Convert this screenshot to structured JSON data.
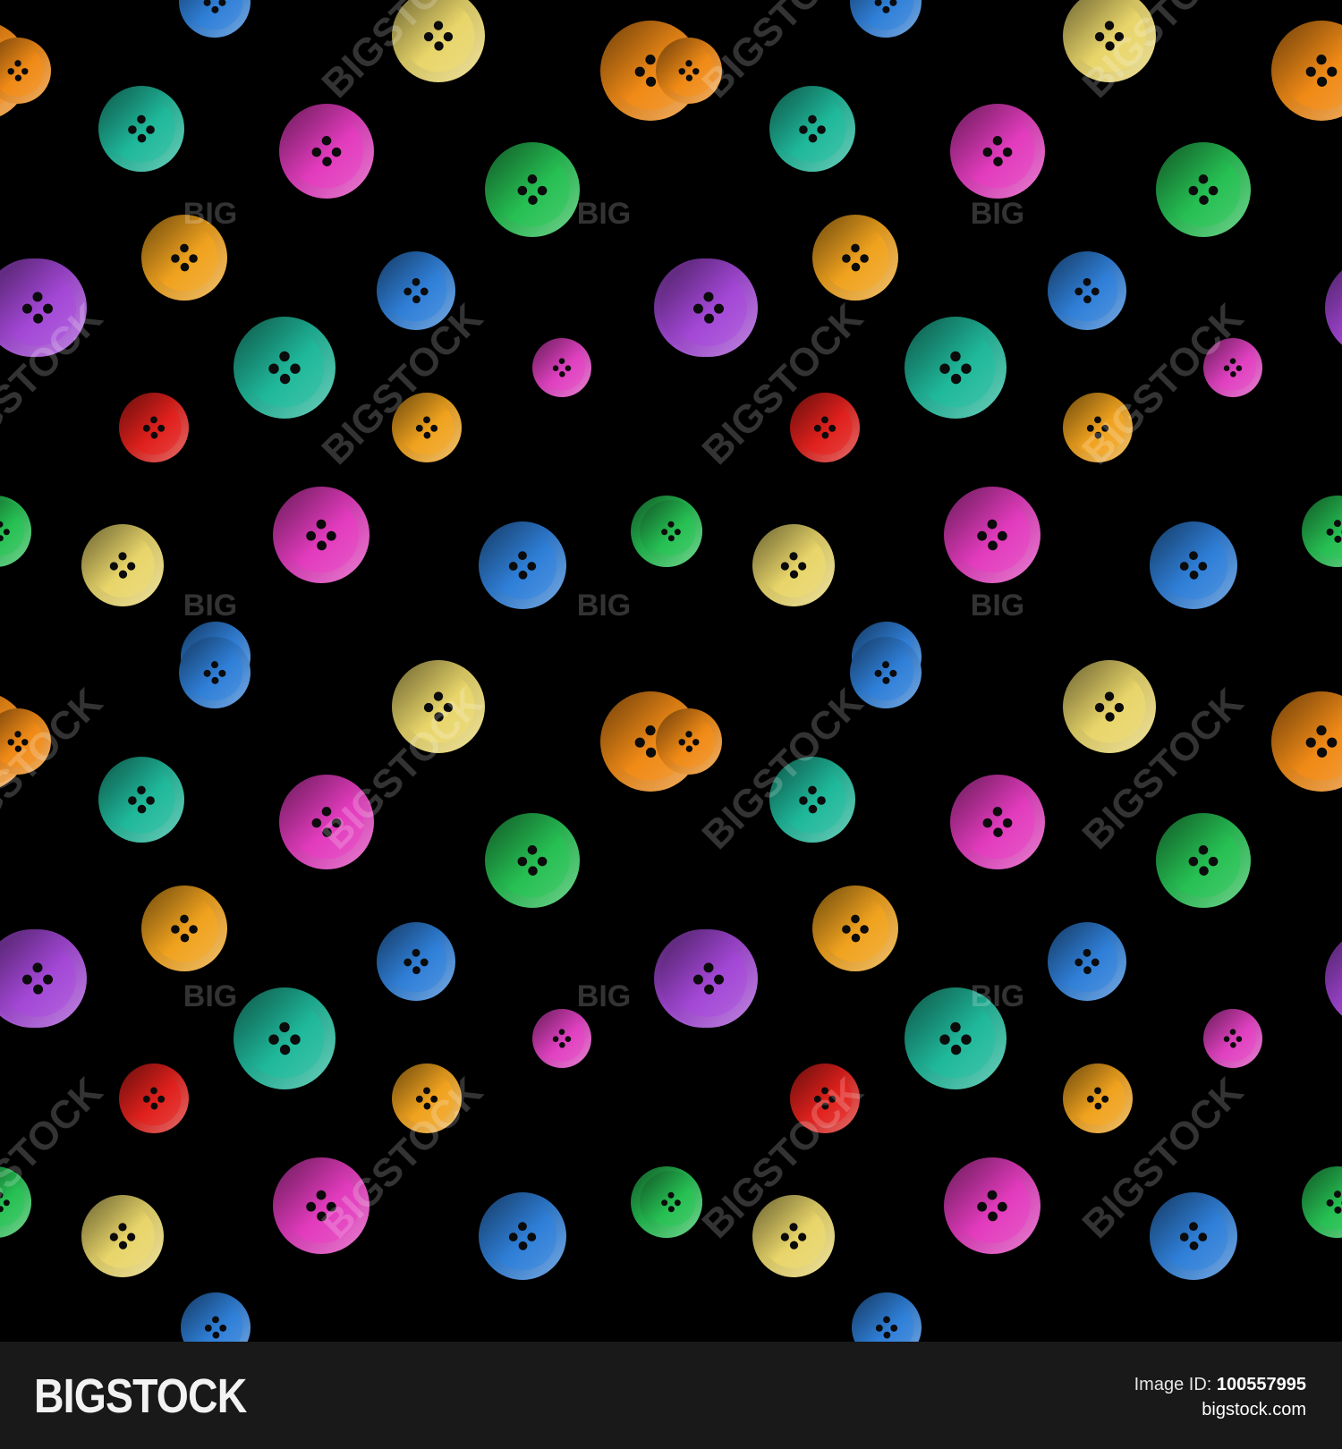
{
  "watermark": {
    "long": "BIGSTOCK",
    "short": "BIG"
  },
  "footer": {
    "brand": "BIGSTOCK",
    "image_id_label": "Image ID:",
    "image_id": "100557995",
    "site": "bigstock.com"
  },
  "colors": {
    "background": "#000000",
    "footer_bg": "#191919",
    "teal": "#1fb89a",
    "magenta": "#e23bbd",
    "green": "#26c053",
    "yellow": "#e8d56a",
    "orange": "#f08a16",
    "amber": "#f0a21e",
    "purple": "#a347d6",
    "blue": "#2f7fd8",
    "red": "#e0201c",
    "pink": "#e040c0"
  },
  "buttons": [
    {
      "color": "blue"
    },
    {
      "color": "yellow"
    },
    {
      "color": "orange"
    },
    {
      "color": "orange"
    },
    {
      "color": "teal"
    },
    {
      "color": "magenta"
    },
    {
      "color": "green"
    },
    {
      "color": "amber"
    },
    {
      "color": "purple"
    },
    {
      "color": "blue"
    },
    {
      "color": "purple"
    },
    {
      "color": "teal"
    },
    {
      "color": "pink"
    },
    {
      "color": "red"
    },
    {
      "color": "amber"
    },
    {
      "color": "green"
    },
    {
      "color": "yellow"
    },
    {
      "color": "magenta"
    },
    {
      "color": "blue"
    },
    {
      "color": "green"
    },
    {
      "color": "blue"
    }
  ]
}
